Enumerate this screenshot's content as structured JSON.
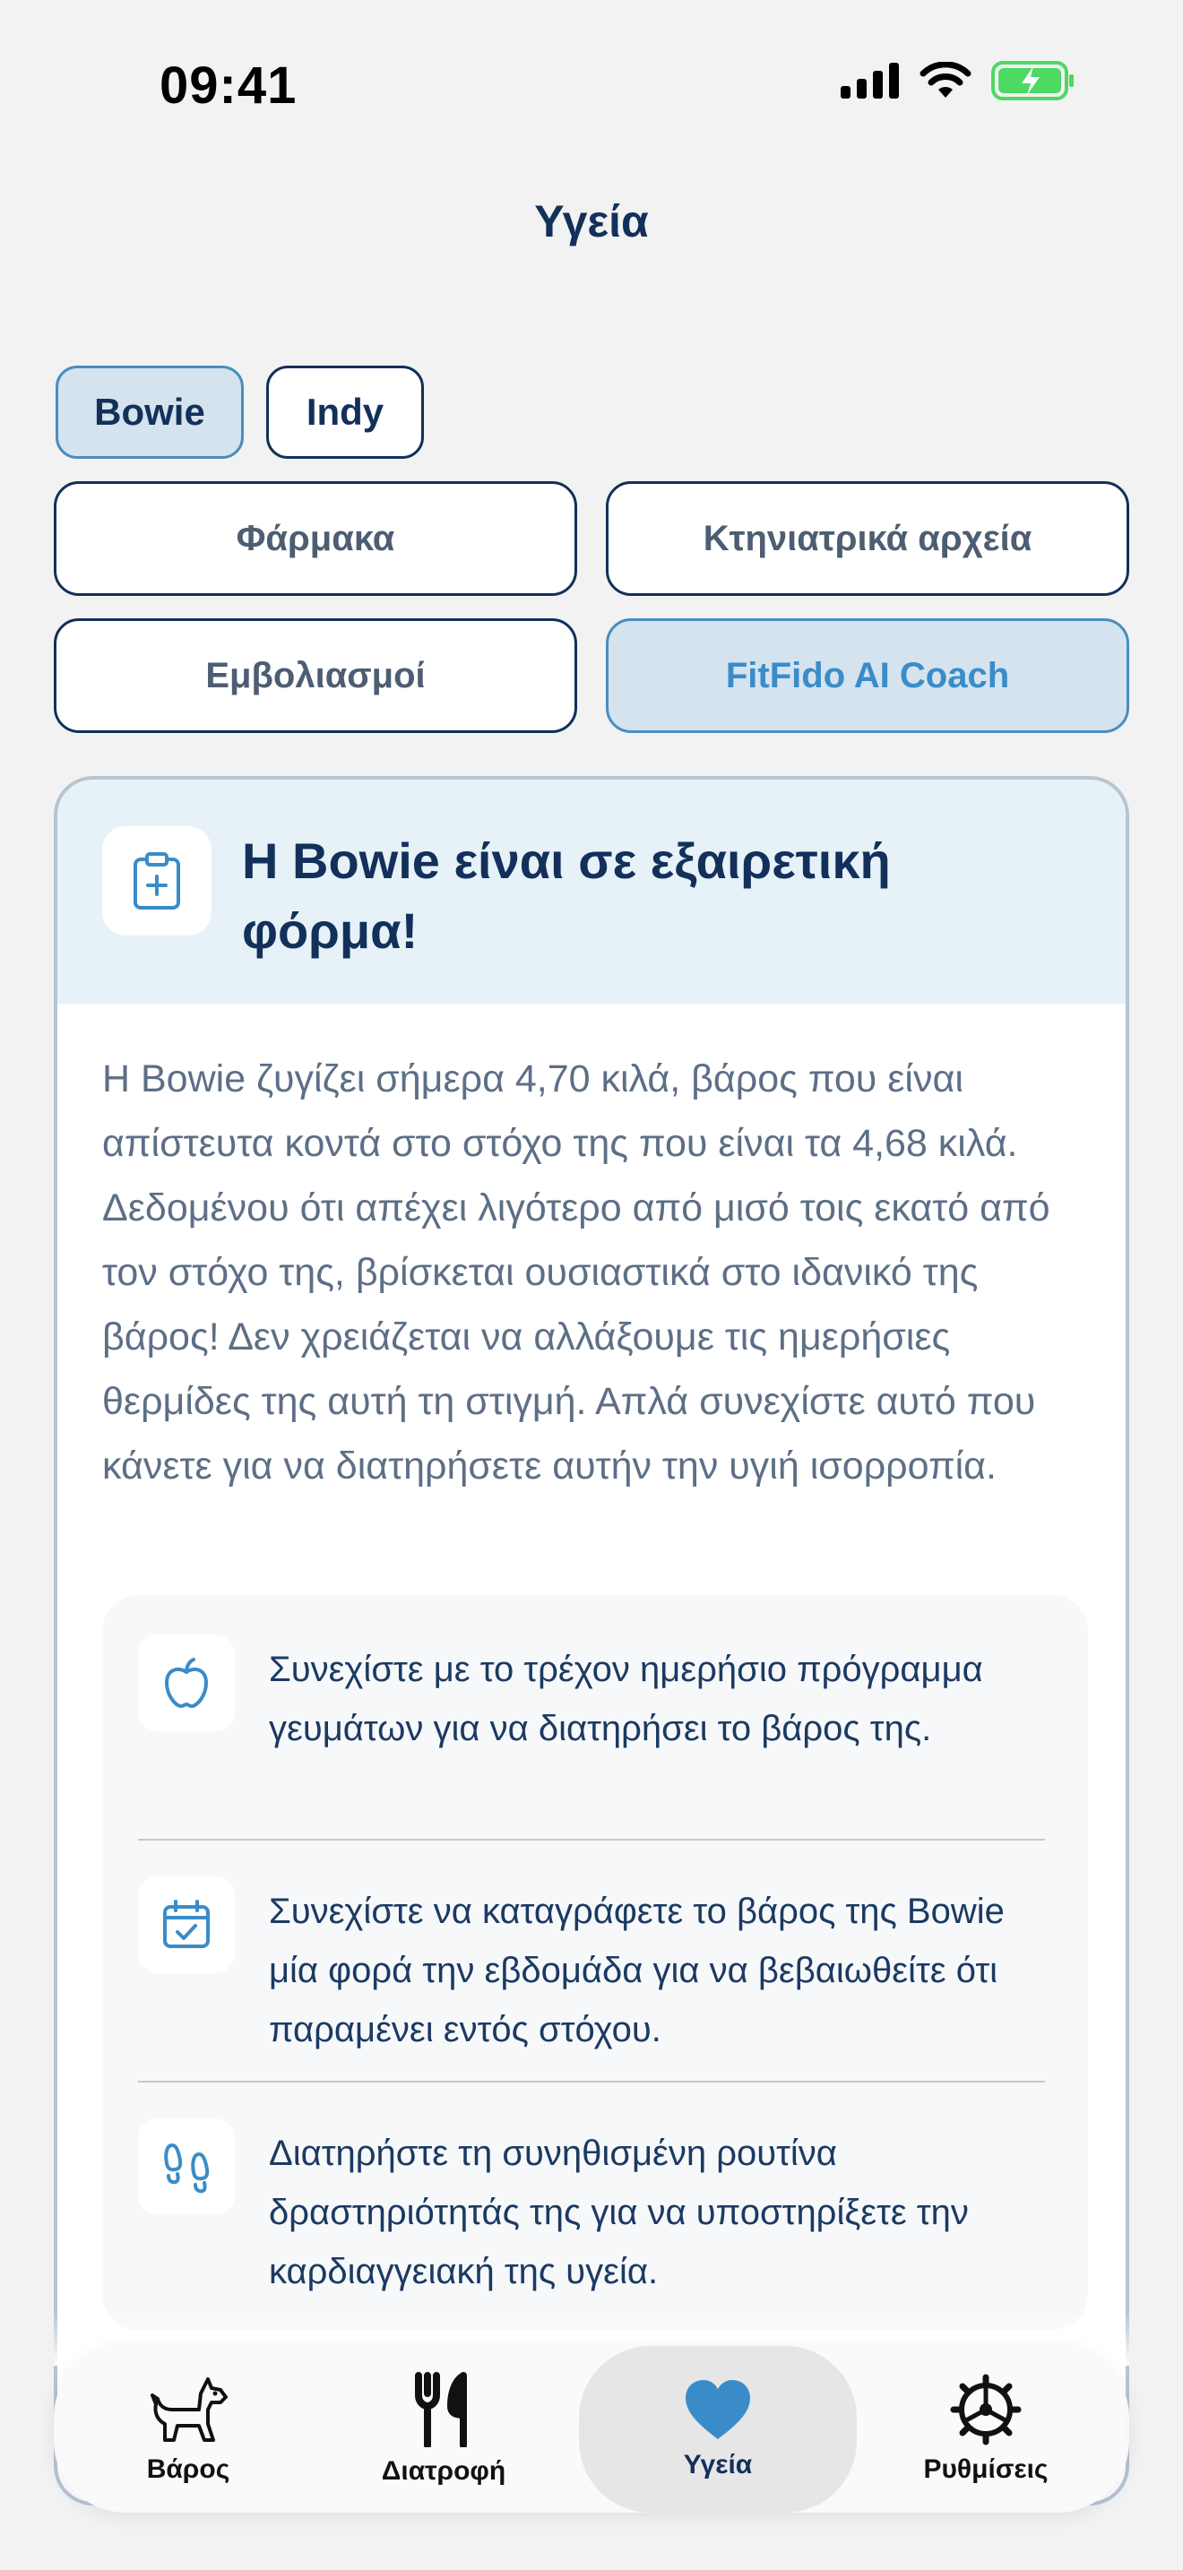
{
  "status": {
    "time": "09:41"
  },
  "header": {
    "title": "Υγεία"
  },
  "pets": [
    {
      "name": "Bowie",
      "active": true
    },
    {
      "name": "Indy",
      "active": false
    }
  ],
  "tabs": [
    {
      "label": "Φάρμακα",
      "active": false
    },
    {
      "label": "Κτηνιατρικά αρχεία",
      "active": false
    },
    {
      "label": "Εμβολιασμοί",
      "active": false
    },
    {
      "label": "FitFido AI Coach",
      "active": true
    }
  ],
  "coach": {
    "title": "Η Bowie είναι σε εξαιρετική φόρμα!",
    "body": "Η Bowie ζυγίζει σήμερα 4,70 κιλά, βάρος που είναι απίστευτα κοντά στο στόχο της που είναι τα 4,68 κιλά. Δεδομένου ότι απέχει λιγότερο από μισό τοις εκατό από τον στόχο της, βρίσκεται ουσιαστικά στο ιδανικό της βάρος! Δεν χρειάζεται να αλλάξουμε τις ημερήσιες θερμίδες της αυτή τη στιγμή. Απλά συνεχίστε αυτό που κάνετε για να διατηρήσετε αυτήν την υγιή ισορροπία.",
    "tips": [
      {
        "icon": "apple-icon",
        "text": "Συνεχίστε με το τρέχον ημερήσιο πρόγραμμα γευμάτων για να διατηρήσει το βάρος της."
      },
      {
        "icon": "calendar-check-icon",
        "text": "Συνεχίστε να καταγράφετε το βάρος της Bowie μία φορά την εβδομάδα για να βεβαιωθείτε ότι παραμένει εντός στόχου."
      },
      {
        "icon": "footprints-icon",
        "text": "Διατηρήστε τη συνηθισμένη ρουτίνα δραστηριότητάς της για να υποστηρίξετε την καρδιαγγειακή της υγεία."
      }
    ]
  },
  "nav": [
    {
      "label": "Βάρος",
      "icon": "dog-icon",
      "active": false
    },
    {
      "label": "Διατροφή",
      "icon": "fork-knife-icon",
      "active": false
    },
    {
      "label": "Υγεία",
      "icon": "heart-icon",
      "active": true
    },
    {
      "label": "Ρυθμίσεις",
      "icon": "gear-icon",
      "active": false
    }
  ],
  "colors": {
    "primary": "#12305a",
    "accent": "#3a8cc9",
    "active_bg": "#d4e3ee",
    "battery": "#4cd964"
  }
}
